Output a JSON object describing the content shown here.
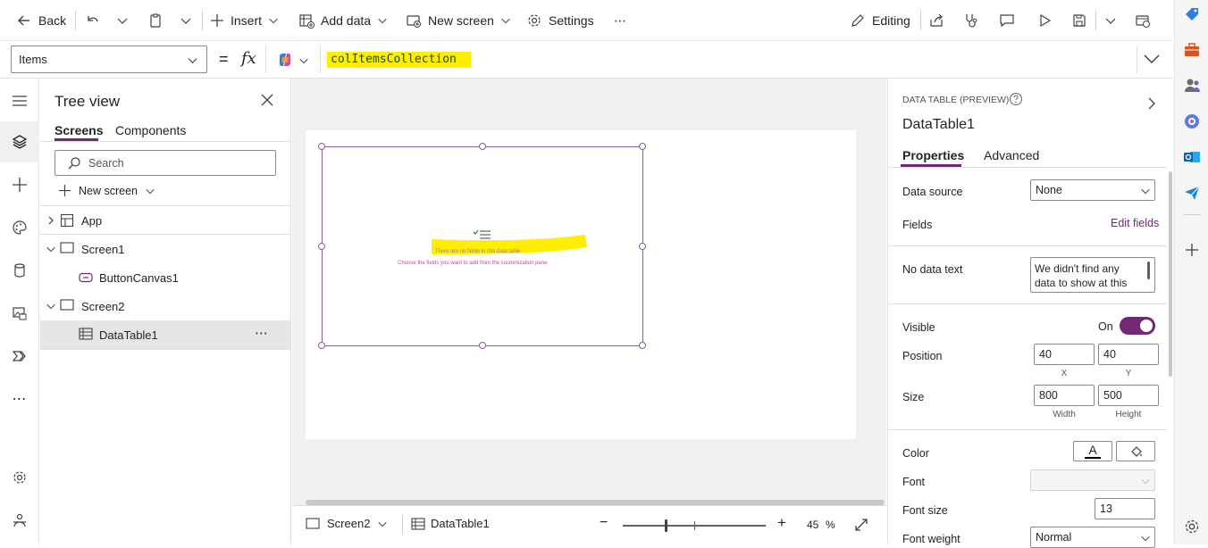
{
  "command_bar": {
    "back_label": "Back",
    "insert_label": "Insert",
    "add_data_label": "Add data",
    "new_screen_label": "New screen",
    "settings_label": "Settings",
    "more_label": "⋯",
    "editing_label": "Editing"
  },
  "formula_bar": {
    "property": "Items",
    "equals": "=",
    "fx": "fx",
    "formula": "colItemsCollection"
  },
  "tree_view": {
    "title": "Tree view",
    "tabs": [
      "Screens",
      "Components"
    ],
    "search_placeholder": "Search",
    "new_screen_label": "New screen",
    "items": [
      {
        "label": "App"
      },
      {
        "label": "Screen1"
      },
      {
        "label": "ButtonCanvas1"
      },
      {
        "label": "Screen2"
      },
      {
        "label": "DataTable1"
      }
    ],
    "more_label": "⋯"
  },
  "canvas": {
    "empty_title": "There are no fields in this data table",
    "empty_hint": "Choose the fields you want to add from the customization pane"
  },
  "status_bar": {
    "screen": "Screen2",
    "control": "DataTable1",
    "zoom_minus": "−",
    "zoom_plus": "+",
    "zoom_value": "45",
    "zoom_unit": "%",
    "zoom_fraction": 0.3
  },
  "properties": {
    "type_label": "DATA TABLE (PREVIEW)",
    "control_name": "DataTable1",
    "tabs": [
      "Properties",
      "Advanced"
    ],
    "data_source_label": "Data source",
    "data_source_value": "None",
    "fields_label": "Fields",
    "edit_fields_label": "Edit fields",
    "no_data_text_label": "No data text",
    "no_data_text_value": "We didn't find any data to show at this",
    "visible_label": "Visible",
    "visible_value": "On",
    "position_label": "Position",
    "x_value": "40",
    "y_value": "40",
    "x_label": "X",
    "y_label": "Y",
    "size_label": "Size",
    "width_value": "800",
    "height_value": "500",
    "width_label": "Width",
    "height_label": "Height",
    "color_label": "Color",
    "color_text_glyph": "A",
    "font_label": "Font",
    "font_value": "",
    "font_size_label": "Font size",
    "font_size_value": "13",
    "font_weight_label": "Font weight",
    "font_weight_value": "Normal"
  },
  "colors": {
    "accent": "#742774",
    "highlight": "#ffee00",
    "selection": "#8a5a9e"
  }
}
